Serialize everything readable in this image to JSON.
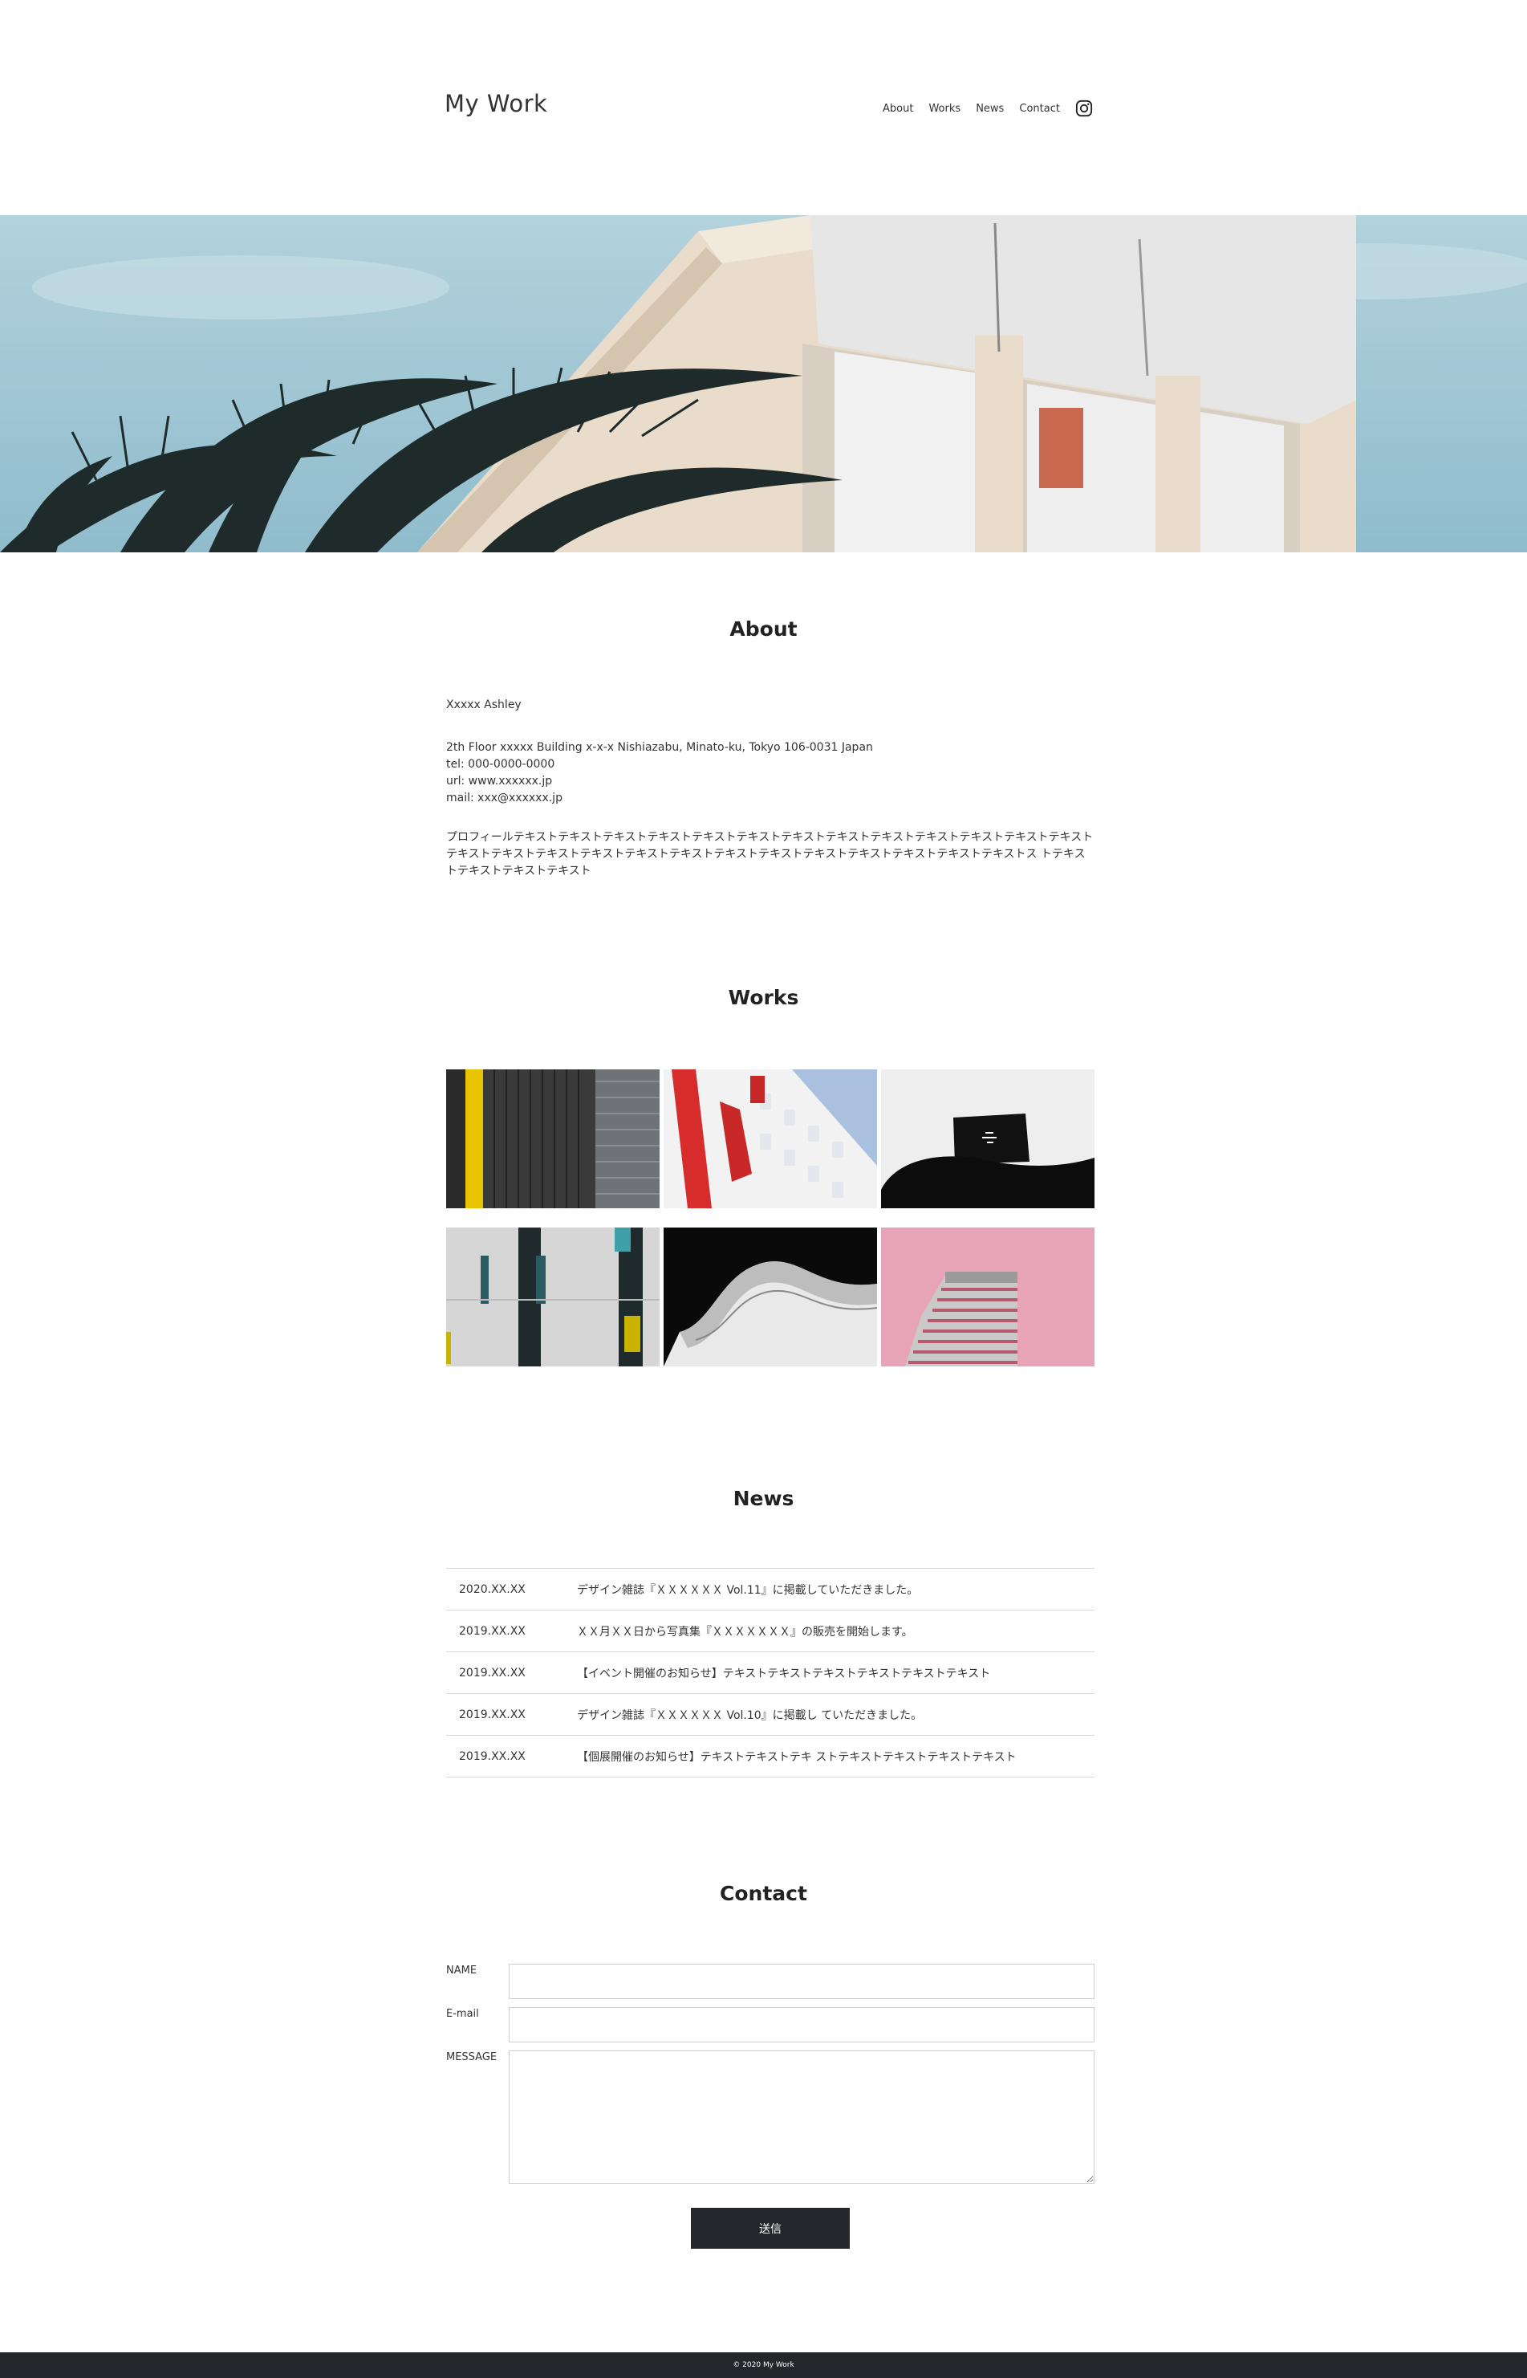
{
  "header": {
    "logo": "My Work",
    "nav": [
      {
        "label": "About"
      },
      {
        "label": "Works"
      },
      {
        "label": "News"
      },
      {
        "label": "Contact"
      }
    ],
    "social_icon": "instagram-icon"
  },
  "about": {
    "title": "About",
    "name": "Xxxxx Ashley",
    "address_lines": [
      "2th Floor xxxxx Building x-x-x Nishiazabu, Minato-ku, Tokyo 106-0031 Japan",
      "tel: 000-0000-0000",
      "url: www.xxxxxx.jp",
      "mail: xxx@xxxxxx.jp"
    ],
    "profile": "プロフィールテキストテキストテキストテキストテキストテキストテキストテキストテキストテキストテキストテキストテキストテキストテキストテキストテキストテキストテキストテキストテキストテキストテキストテキストテキストテキストス トテキストテキストテキストテキスト"
  },
  "works": {
    "title": "Works",
    "items": [
      {
        "subject": "black-yellow-facade"
      },
      {
        "subject": "red-white-building"
      },
      {
        "subject": "black-chair-screen"
      },
      {
        "subject": "grey-windows-facade"
      },
      {
        "subject": "white-curved-building"
      },
      {
        "subject": "pink-tower"
      }
    ]
  },
  "news": {
    "title": "News",
    "items": [
      {
        "date": "2020.XX.XX",
        "text": "デザイン雑誌『ＸＸＸＸＸＸ Vol.11』に掲載していただきました。"
      },
      {
        "date": "2019.XX.XX",
        "text": "ＸＸ月ＸＸ日から写真集『ＸＸＸＸＸＸＸ』の販売を開始します。"
      },
      {
        "date": "2019.XX.XX",
        "text": "【イベント開催のお知らせ】テキストテキストテキストテキストテキストテキスト"
      },
      {
        "date": "2019.XX.XX",
        "text": "デザイン雑誌『ＸＸＸＸＸＸ Vol.10』に掲載し ていただきました。"
      },
      {
        "date": "2019.XX.XX",
        "text": "【個展開催のお知らせ】テキストテキストテキ ストテキストテキストテキストテキスト"
      }
    ]
  },
  "contact": {
    "title": "Contact",
    "name_label": "NAME",
    "name_value": "",
    "email_label": "E-mail",
    "email_value": "",
    "message_label": "MESSAGE",
    "message_value": "",
    "submit_label": "送信"
  },
  "footer": {
    "copyright": "© 2020 My Work"
  },
  "colors": {
    "text": "#333333",
    "dark": "#23272b",
    "border": "#d6d6d6",
    "background": "#ffffff"
  }
}
